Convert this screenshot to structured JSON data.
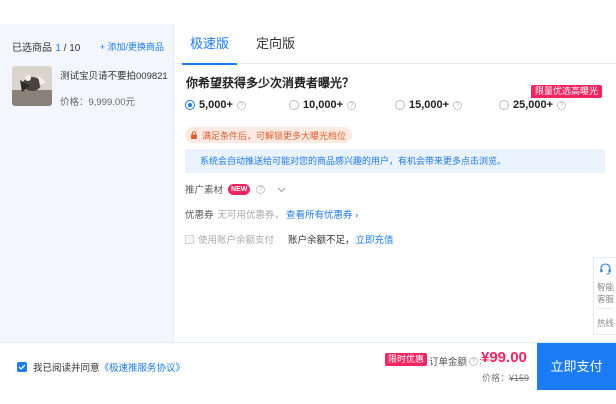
{
  "left": {
    "selected_label": "已选商品",
    "selected_current": "1",
    "selected_total": " / 10",
    "add_link": "+ 添加/更换商品",
    "product": {
      "name": "测试宝贝请不要拍009821",
      "price": "价格：9,999.00元"
    }
  },
  "tabs": [
    {
      "label": "极速版",
      "active": true
    },
    {
      "label": "定向版",
      "active": false
    }
  ],
  "main": {
    "question": "你希望获得多少次消费者曝光？",
    "hot_badge": "限量优选高曝光",
    "options": [
      {
        "label": "5,000+",
        "selected": true
      },
      {
        "label": "10,000+",
        "selected": false
      },
      {
        "label": "15,000+",
        "selected": false
      },
      {
        "label": "25,000+",
        "selected": false
      }
    ],
    "unlock_text": "满足条件后，可解锁更多大曝光档位",
    "info_text": "系统会自动推送给可能对您的商品感兴趣的用户，有机会带来更多点击浏览。",
    "material_label": "推广素材",
    "new_badge": "NEW",
    "coupon_label": "优惠券",
    "coupon_none": "无可用优惠券，",
    "coupon_link": "查看所有优惠券 ›",
    "balance_label": "使用账户余额支付",
    "balance_note": "账户余额不足，",
    "balance_link": "立即充值"
  },
  "tools": {
    "service_line1": "智能",
    "service_line2": "客服",
    "hotline": "热线"
  },
  "bottom": {
    "agree_text": "我已阅读并同意",
    "agree_link": "《极速推服务协议》",
    "limited_badge": "限时优惠",
    "order_label": "订单金额",
    "total": "¥99.00",
    "orig_label": "价格：",
    "orig_price": "¥159",
    "pay_button": "立即支付"
  },
  "colors": {
    "accent": "#1b7bf5",
    "hot": "#f5245f",
    "warn": "#e25b2a"
  }
}
